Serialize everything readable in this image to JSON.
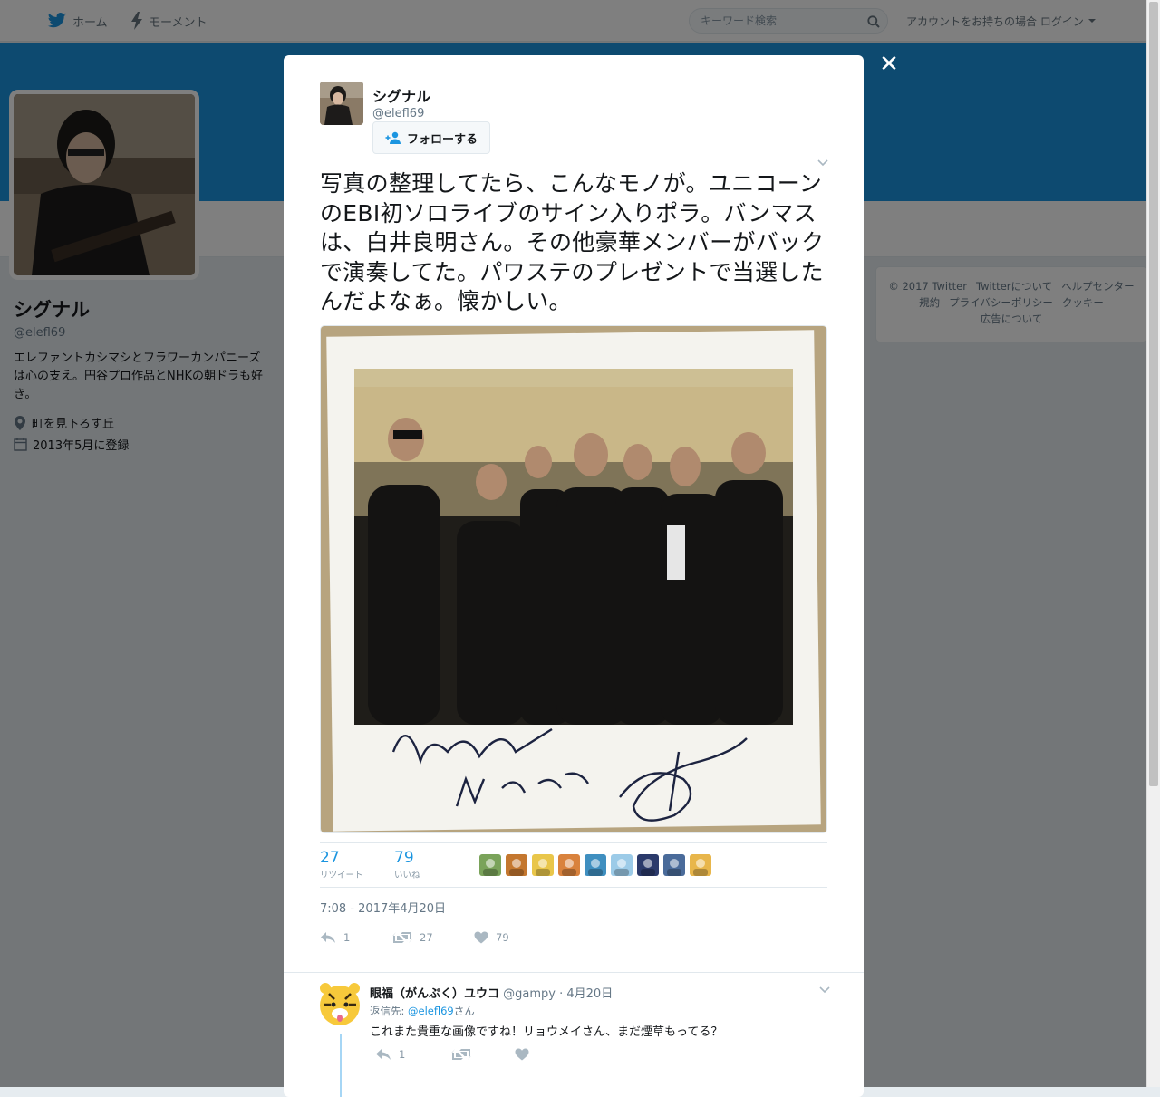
{
  "topnav": {
    "home_label": "ホーム",
    "moments_label": "モーメント",
    "search_placeholder": "キーワード検索",
    "login_label": "アカウントをお持ちの場合 ログイン"
  },
  "profile": {
    "name": "シグナル",
    "handle": "@elefl69",
    "bio": "エレファントカシマシとフラワーカンパニーズは心の支え。円谷プロ作品とNHKの朝ドラも好き。",
    "location": "町を見下ろす丘",
    "joined": "2013年5月に登録"
  },
  "footer": {
    "links_row1": [
      "© 2017 Twitter",
      "Twitterについて",
      "ヘルプセンター"
    ],
    "links_row2": [
      "規約",
      "プライバシーポリシー",
      "クッキー"
    ],
    "links_row3": [
      "広告について"
    ]
  },
  "tweet": {
    "author_name": "シグナル",
    "author_handle": "@elefl69",
    "follow_label": "フォローする",
    "text": "写真の整理してたら、こんなモノが。ユニコーンのEBI初ソロライブのサイン入りポラ。バンマスは、白井良明さん。その他豪華メンバーがバックで演奏してた。パワステのプレゼントで当選したんだよなぁ。懐かしい。",
    "retweets_count": "27",
    "retweets_label": "リツイート",
    "likes_count": "79",
    "likes_label": "いいね",
    "timestamp": "7:08 - 2017年4月20日",
    "reply_count": "1",
    "retweet_action_count": "27",
    "like_action_count": "79",
    "photo_signature_text": "Have a Mr.SEE",
    "liker_colors": [
      "#7aa35a",
      "#c4772f",
      "#e9c64a",
      "#d9823d",
      "#3f8fc0",
      "#9ccbe8",
      "#2b3a6b",
      "#4a6b9a",
      "#e8b64b"
    ]
  },
  "reply": {
    "name": "眼福（がんぷく）ユウコ",
    "handle": "@gampy",
    "date": "· 4月20日",
    "reply_to_prefix": "返信先: ",
    "reply_to_handle": "@elefl69",
    "reply_to_suffix": "さん",
    "text": "これまた貴重な画像ですね！リョウメイさん、まだ煙草もってる？",
    "reply_count": "1"
  },
  "colors": {
    "brand": "#1b95e0",
    "banner": "#1b95e0",
    "muted": "#657786"
  },
  "icons": {
    "home": "twitter-bird-icon",
    "moments": "lightning-icon",
    "search": "search-icon",
    "close": "close-icon"
  }
}
